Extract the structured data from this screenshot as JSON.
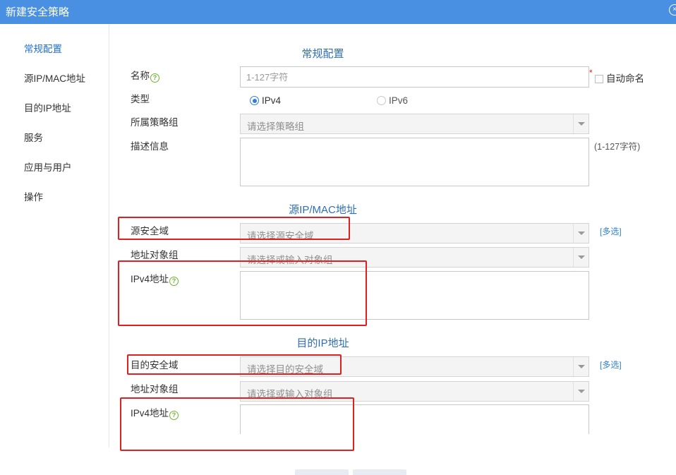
{
  "window": {
    "title": "新建安全策略"
  },
  "sidebar": {
    "items": [
      {
        "label": "常规配置",
        "active": true
      },
      {
        "label": "源IP/MAC地址"
      },
      {
        "label": "目的IP地址"
      },
      {
        "label": "服务"
      },
      {
        "label": "应用与用户"
      },
      {
        "label": "操作"
      }
    ]
  },
  "general": {
    "section_title": "常规配置",
    "name_label": "名称",
    "name_placeholder": "1-127字符",
    "auto_name_label": "自动命名",
    "type_label": "类型",
    "type_options": [
      "IPv4",
      "IPv6"
    ],
    "type_selected": "IPv4",
    "group_label": "所属策略组",
    "group_placeholder": "请选择策略组",
    "desc_label": "描述信息",
    "desc_hint": "(1-127字符)"
  },
  "source": {
    "section_title": "源IP/MAC地址",
    "zone_label": "源安全域",
    "zone_placeholder": "请选择源安全域",
    "multi_label": "[多选]",
    "addr_group_label": "地址对象组",
    "addr_group_placeholder": "请选择或输入对象组",
    "ipv4_label": "IPv4地址"
  },
  "destination": {
    "section_title": "目的IP地址",
    "zone_label": "目的安全域",
    "zone_placeholder": "请选择目的安全域",
    "multi_label": "[多选]",
    "addr_group_label": "地址对象组",
    "addr_group_placeholder": "请选择或输入对象组",
    "ipv4_label": "IPv4地址"
  },
  "colors": {
    "titlebar": "#4a90e2",
    "accent": "#2f7fd8",
    "section_title": "#2f6fb3",
    "highlight": "#e02020",
    "help_icon": "#6fb22f"
  },
  "icons": {
    "help": "question-circle-icon",
    "dropdown": "triangle-down-icon",
    "close": "close-circle-icon"
  }
}
